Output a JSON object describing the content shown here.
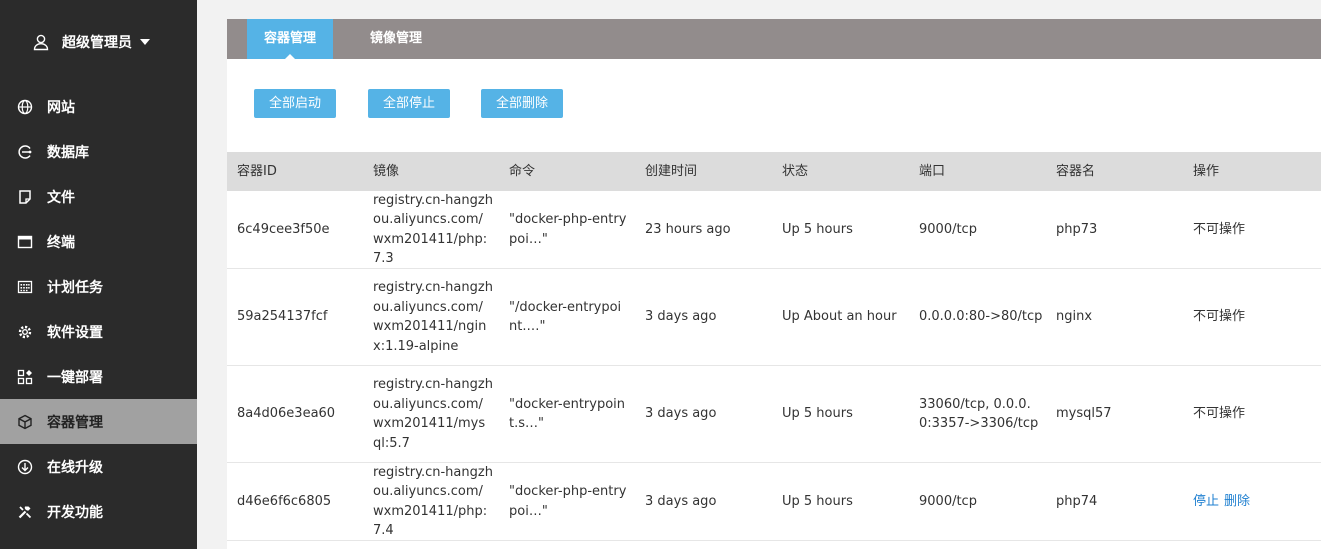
{
  "user": {
    "name": "超级管理员"
  },
  "menu": [
    {
      "label": "网站",
      "icon": "globe-icon"
    },
    {
      "label": "数据库",
      "icon": "database-icon"
    },
    {
      "label": "文件",
      "icon": "file-icon"
    },
    {
      "label": "终端",
      "icon": "terminal-icon"
    },
    {
      "label": "计划任务",
      "icon": "calendar-icon"
    },
    {
      "label": "软件设置",
      "icon": "gear-icon"
    },
    {
      "label": "一键部署",
      "icon": "apps-icon"
    },
    {
      "label": "容器管理",
      "icon": "cube-icon",
      "active": true
    },
    {
      "label": "在线升级",
      "icon": "upgrade-icon"
    },
    {
      "label": "开发功能",
      "icon": "tools-icon"
    }
  ],
  "tabs": {
    "containers": "容器管理",
    "images": "镜像管理"
  },
  "buttons": {
    "start_all": "全部启动",
    "stop_all": "全部停止",
    "delete_all": "全部删除"
  },
  "table": {
    "headers": [
      "容器ID",
      "镜像",
      "命令",
      "创建时间",
      "状态",
      "端口",
      "容器名",
      "操作"
    ],
    "rows": [
      {
        "id": "6c49cee3f50e",
        "image": "registry.cn-hangzhou.aliyuncs.com/wxm201411/php:7.3",
        "command": "\"docker-php-entrypoi…\"",
        "created": "23 hours ago",
        "status": "Up 5 hours",
        "ports": "9000/tcp",
        "name": "php73",
        "action": "不可操作"
      },
      {
        "id": "59a254137fcf",
        "image": "registry.cn-hangzhou.aliyuncs.com/wxm201411/nginx:1.19-alpine",
        "command": "\"/docker-entrypoint.…\"",
        "created": "3 days ago",
        "status": "Up About an hour",
        "ports": "0.0.0.0:80->80/tcp",
        "name": "nginx",
        "action": "不可操作"
      },
      {
        "id": "8a4d06e3ea60",
        "image": "registry.cn-hangzhou.aliyuncs.com/wxm201411/mysql:5.7",
        "command": "\"docker-entrypoint.s…\"",
        "created": "3 days ago",
        "status": "Up 5 hours",
        "ports": "33060/tcp, 0.0.0.0:3357->3306/tcp",
        "name": "mysql57",
        "action": "不可操作"
      },
      {
        "id": "d46e6f6c6805",
        "image": "registry.cn-hangzhou.aliyuncs.com/wxm201411/php:7.4",
        "command": "\"docker-php-entrypoi…\"",
        "created": "3 days ago",
        "status": "Up 5 hours",
        "ports": "9000/tcp",
        "name": "php74",
        "action_stop": "停止",
        "action_delete": "删除"
      }
    ]
  },
  "colors": {
    "sidebar": "#2b2b2b",
    "accent": "#55b3e6",
    "tabbar": "#928c8c",
    "link": "#1e7fd0"
  }
}
